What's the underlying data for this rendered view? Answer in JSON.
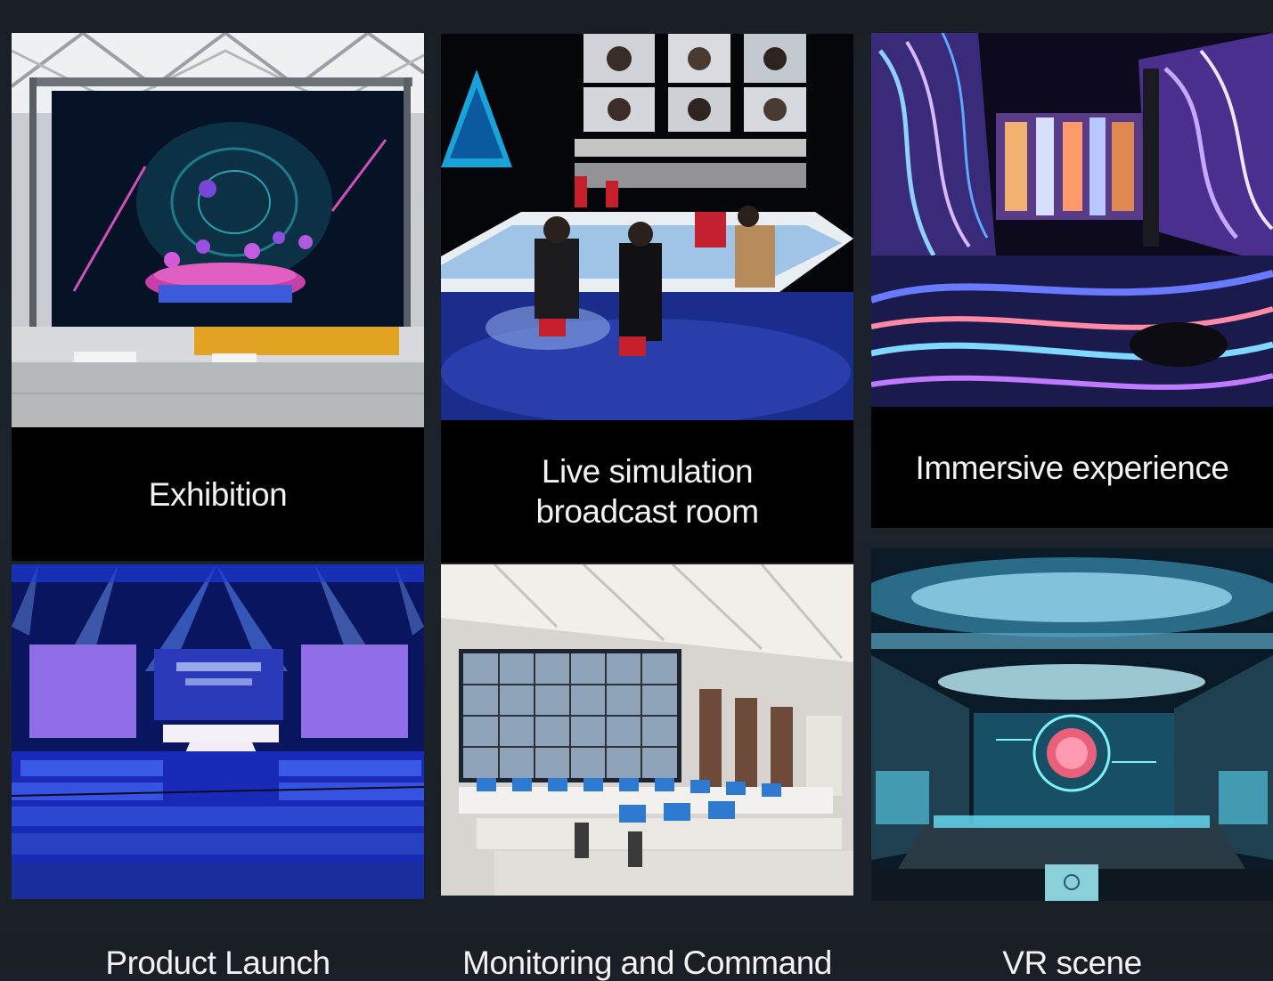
{
  "cards": [
    {
      "caption": "Exhibition"
    },
    {
      "caption": "Live simulation\nbroadcast room"
    },
    {
      "caption": "Immersive experience"
    },
    {
      "caption": "Product Launch"
    },
    {
      "caption": "Monitoring and Command"
    },
    {
      "caption": "VR scene"
    }
  ]
}
